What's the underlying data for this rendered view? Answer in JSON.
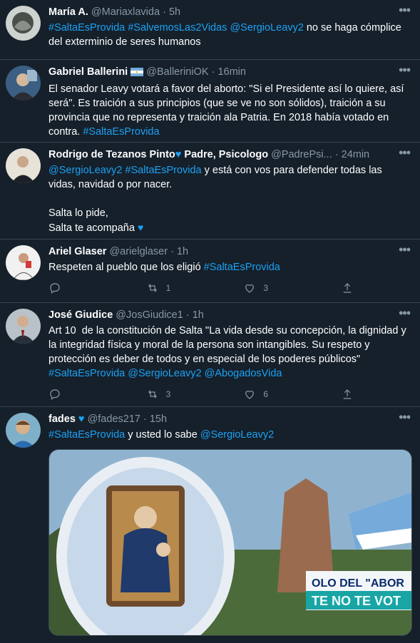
{
  "tweets": [
    {
      "name": "María A.",
      "handle": "@Mariaxlavida",
      "sep": "·",
      "time": "5h",
      "body": [
        {
          "t": "#SaltaEsProvida",
          "link": true
        },
        {
          "t": " ",
          "link": false
        },
        {
          "t": "#SalvemosLas2Vidas",
          "link": true
        },
        {
          "t": " ",
          "link": false
        },
        {
          "t": "@SergioLeavy2",
          "link": true
        },
        {
          "t": " no se haga cómplice del exterminio de seres humanos",
          "link": false
        }
      ]
    },
    {
      "name": "Gabriel Ballerini",
      "handle": "@BalleriniOK",
      "sep": "·",
      "time": "16min",
      "flag": "argentina-flag-icon",
      "body": [
        {
          "t": "El senador Leavy votará a favor del aborto: \"Si el Presidente así lo quiere, así será\". Es traición a sus principios (que se ve no son sólidos), traición a su provincia que no representa y traición ala Patria. En 2018 había votado en contra. ",
          "link": false
        },
        {
          "t": "#SaltaEsProvida",
          "link": true
        }
      ]
    },
    {
      "name": "Rodrigo de Tezanos Pinto",
      "name_suffix": " Padre, Psicologo",
      "handle": "@PadrePsi...",
      "sep": "·",
      "time": "24min",
      "body": [
        {
          "t": "@SergioLeavy2",
          "link": true
        },
        {
          "t": " ",
          "link": false
        },
        {
          "t": "#SaltaEsProvida",
          "link": true
        },
        {
          "t": " y está con vos para defender todas las vidas, navidad o por nacer.\n\nSalta lo pide,\nSalta te acompaña ",
          "link": false
        }
      ]
    },
    {
      "name": "Ariel Glaser",
      "handle": "@arielglaser",
      "sep": "·",
      "time": "1h",
      "body": [
        {
          "t": "Respeten al pueblo que los eligió ",
          "link": false
        },
        {
          "t": "#SaltaEsProvida",
          "link": true
        }
      ],
      "actions": {
        "retweets": "1",
        "likes": "3"
      }
    },
    {
      "name": "José Giudice",
      "handle": "@JosGiudice1",
      "sep": "·",
      "time": "1h",
      "body": [
        {
          "t": "Art 10  de la constitución de Salta \"La vida desde su concepción, la dignidad y la integridad física y moral de la persona son intangibles. Su respeto y protección es deber de todos y en especial de los poderes públicos\"\n",
          "link": false
        },
        {
          "t": "#SaltaEsProvida",
          "link": true
        },
        {
          "t": " ",
          "link": false
        },
        {
          "t": "@SergioLeavy2",
          "link": true
        },
        {
          "t": " ",
          "link": false
        },
        {
          "t": "@AbogadosVida",
          "link": true
        }
      ],
      "actions": {
        "retweets": "3",
        "likes": "6"
      }
    },
    {
      "name": "fades",
      "handle": "@fades217",
      "sep": "·",
      "time": "15h",
      "body": [
        {
          "t": "#SaltaEsProvida",
          "link": true
        },
        {
          "t": " y usted lo sabe ",
          "link": false
        },
        {
          "t": "@SergioLeavy2",
          "link": true
        }
      ],
      "media": {
        "banner_line1": "OLO DEL \"ABOR",
        "banner_line2": "TE NO TE VOT"
      }
    }
  ],
  "icons": {
    "more": "more-icon",
    "reply": "reply-icon",
    "retweet": "retweet-icon",
    "like": "like-icon",
    "share": "share-icon",
    "heart": "blue-heart-icon"
  },
  "colors": {
    "background": "#15202b",
    "link": "#1da1f2",
    "muted": "#8899a6",
    "divider": "#38444d"
  }
}
